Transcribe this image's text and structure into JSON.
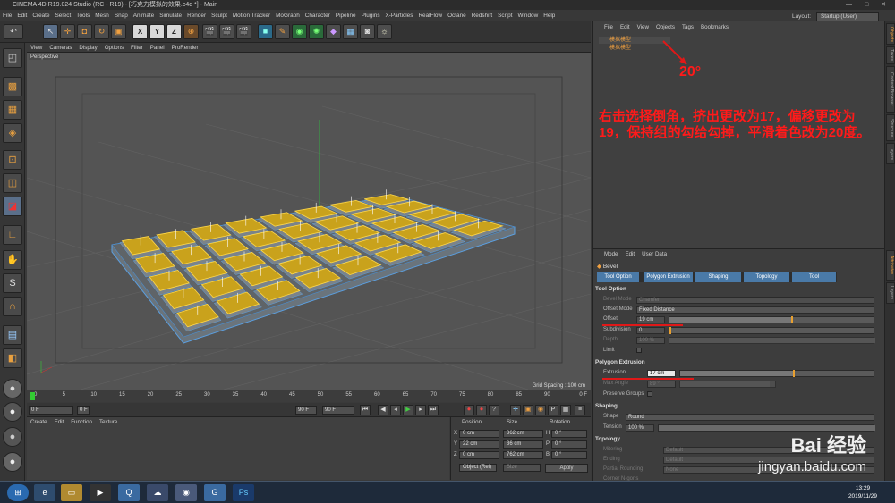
{
  "window": {
    "title": "CINEMA 4D R19.024 Studio (RC - R19) - [巧克力模拟的效果.c4d *] - Main",
    "controls": "— □ ✕"
  },
  "menu": [
    "File",
    "Edit",
    "Create",
    "Select",
    "Tools",
    "Mesh",
    "Snap",
    "Animate",
    "Simulate",
    "Render",
    "Sculpt",
    "Motion Tracker",
    "MoGraph",
    "Character",
    "Pipeline",
    "Plugins",
    "X-Particles",
    "RealFlow",
    "Octane",
    "Redshift",
    "Script",
    "Window",
    "Help"
  ],
  "layout": {
    "label": "Layout:",
    "value": "Startup (User)"
  },
  "viewport_menu": [
    "View",
    "Cameras",
    "Display",
    "Options",
    "Filter",
    "Panel",
    "ProRender"
  ],
  "viewport": {
    "label": "Perspective",
    "grid_spacing": "Grid Spacing : 100 cm"
  },
  "timeline": {
    "ticks": [
      "0",
      "5",
      "10",
      "15",
      "20",
      "25",
      "30",
      "35",
      "40",
      "45",
      "50",
      "55",
      "60",
      "65",
      "70",
      "75",
      "80",
      "85",
      "90"
    ],
    "end_label": "0 F"
  },
  "transport": {
    "start": "0 F",
    "cur": "0 F",
    "end1": "90 F",
    "end2": "90 F"
  },
  "material_menu": [
    "Create",
    "Edit",
    "Function",
    "Texture"
  ],
  "coord": {
    "headers": [
      "Position",
      "Size",
      "Rotation"
    ],
    "rows": [
      {
        "axis": "X",
        "pos": "0 cm",
        "size": "362 cm",
        "rl": "H",
        "rot": "0 °"
      },
      {
        "axis": "Y",
        "pos": "22 cm",
        "size": "36 cm",
        "rl": "P",
        "rot": "0 °"
      },
      {
        "axis": "Z",
        "pos": "0 cm",
        "size": "762 cm",
        "rl": "B",
        "rot": "0 °"
      }
    ],
    "mode": "Object (Rel)",
    "size_mode": "Size",
    "apply": "Apply"
  },
  "object_menu": [
    "File",
    "Edit",
    "View",
    "Objects",
    "Tags",
    "Bookmarks"
  ],
  "objects": [
    "模拟模型",
    "模拟模型"
  ],
  "annotation": {
    "angle": "20°",
    "note": "右击选择倒角，挤出更改为17，偏移更改为19，保持组的勾给勾掉，平滑着色改为20度。"
  },
  "attr_menu": [
    "Mode",
    "Edit",
    "User Data"
  ],
  "attr": {
    "object": "Bevel",
    "tabs": [
      "Tool Option",
      "Polygon Extrusion",
      "Shaping",
      "Topology",
      "Tool"
    ],
    "sections": {
      "tool_option": "Tool Option",
      "polygon_extrusion": "Polygon Extrusion",
      "shaping": "Shaping",
      "topology": "Topology"
    },
    "bevel_mode": {
      "label": "Bevel Mode",
      "value": "Chamfer"
    },
    "offset_mode": {
      "label": "Offset Mode",
      "value": "Fixed Distance"
    },
    "offset": {
      "label": "Offset",
      "value": "19 cm"
    },
    "subdivision": {
      "label": "Subdivision",
      "value": "0"
    },
    "depth": {
      "label": "Depth",
      "value": "100 %"
    },
    "limit": {
      "label": "Limit"
    },
    "extrusion": {
      "label": "Extrusion",
      "value": "17 cm"
    },
    "max_angle": {
      "label": "Max Angle",
      "value": "89 °"
    },
    "preserve_groups": {
      "label": "Preserve Groups"
    },
    "shape": {
      "label": "Shape",
      "value": "Round"
    },
    "tension": {
      "label": "Tension",
      "value": "100 %"
    },
    "mitering": {
      "label": "Mitering",
      "value": "Default"
    },
    "ending": {
      "label": "Ending",
      "value": "Default"
    },
    "partial_rounding": {
      "label": "Partial Rounding",
      "value": "None"
    },
    "corner_ngons": {
      "label": "Corner N-gons"
    }
  },
  "sidebar_tabs": [
    "Objects",
    "Takes",
    "Content Browser",
    "Structure",
    "Layers"
  ],
  "attr_sidebar_tabs": [
    "Attributes",
    "Layers"
  ],
  "taskbar": {
    "time": "13:29",
    "date": "2019/11/29"
  },
  "watermark": {
    "brand": "Bai 经验",
    "url": "jingyan.baidu.com"
  }
}
